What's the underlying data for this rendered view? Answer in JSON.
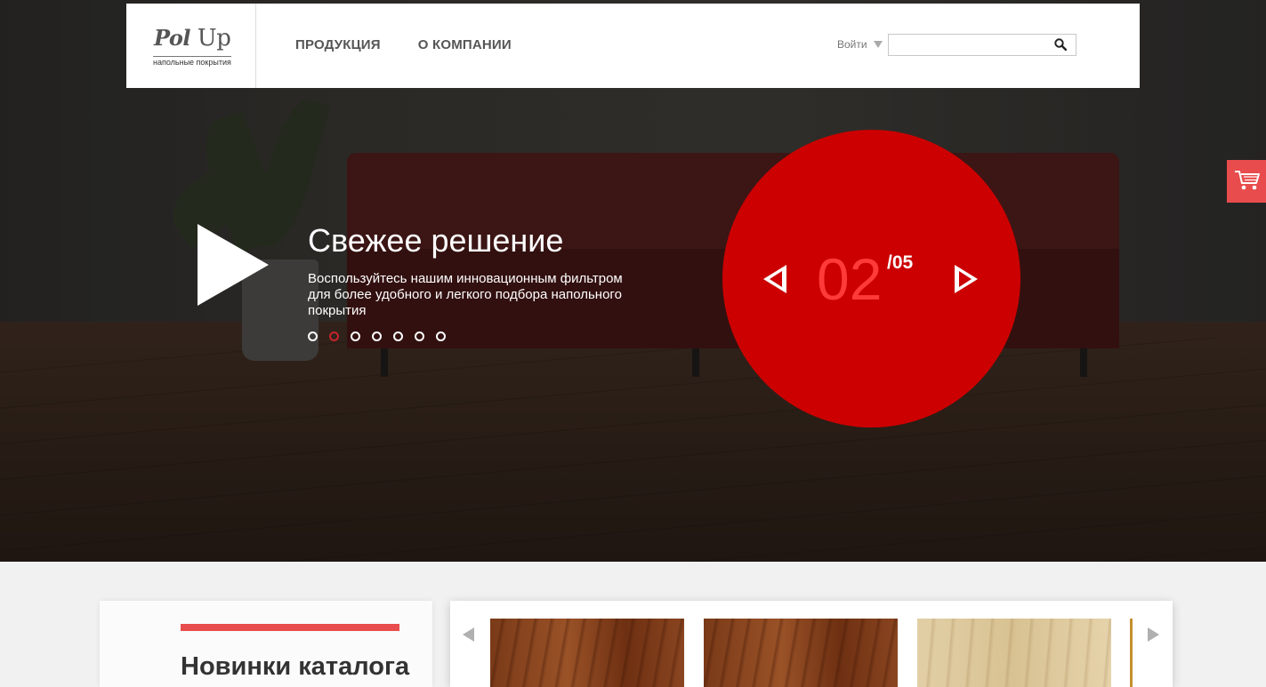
{
  "logo": {
    "brand_a": "Pol",
    "brand_b": "Up",
    "tagline": "напольные покрытия"
  },
  "nav": {
    "items": [
      {
        "label": "ПРОДУКЦИЯ"
      },
      {
        "label": "О КОМПАНИИ"
      }
    ]
  },
  "header": {
    "login_label": "Войти",
    "search_placeholder": ""
  },
  "slide": {
    "title": "Свежее решение",
    "description": "Воспользуйтесь нашим инновационным фильтром для более удобного и легкого подбора напольного покрытия",
    "current": "02",
    "total": "/05",
    "dot_count": 7,
    "active_dot": 1
  },
  "news": {
    "title": "Новинки каталога"
  },
  "colors": {
    "accent": "#cc0000",
    "accent_light": "#e84c4c",
    "counter_text": "#ff3a3a"
  },
  "icons": [
    "search-icon",
    "cart-icon",
    "play-icon",
    "arrow-left-icon",
    "arrow-right-icon"
  ]
}
